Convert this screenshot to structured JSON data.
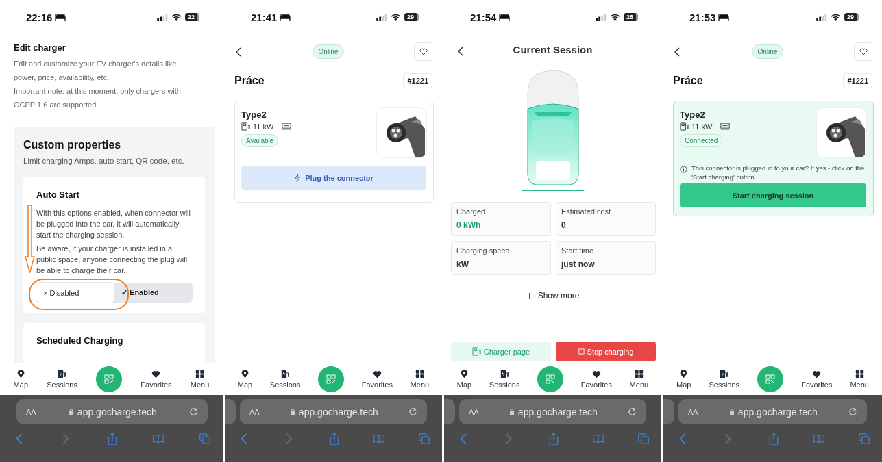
{
  "screens": [
    {
      "kind": "edit_charger",
      "status_bar": {
        "time": "22:16",
        "battery": "22"
      },
      "intro": {
        "title": "Edit charger",
        "paragraphs": [
          "Edit and customize your EV charger's details like power, price, availability, etc.",
          "Important note: at this moment, only chargers with OCPP 1.6 are supported."
        ]
      },
      "section": {
        "title": "Custom properties",
        "subtitle": "Limit charging Amps, auto start, QR code, etc.",
        "cards": [
          {
            "title": "Auto Start",
            "paragraphs": [
              "With this options enabled, when connector will be plugged into the car, it will automatically start the charging session.",
              "Be aware, if your charger is installed in a public space, anyone connecting the plug will be able to charge their car."
            ],
            "options": [
              {
                "icon": "×",
                "label": "Disabled",
                "selected": true
              },
              {
                "icon": "✓",
                "label": "Enabled",
                "selected": false
              }
            ]
          },
          {
            "title": "Scheduled Charging"
          }
        ]
      },
      "nav": [
        "Map",
        "Sessions",
        "Favorites",
        "Menu"
      ],
      "browser": {
        "text_size": "AA",
        "url": "app.gocharge.tech",
        "previous_tab": false
      }
    },
    {
      "kind": "charger",
      "status_bar": {
        "time": "21:41",
        "battery": "29"
      },
      "status": "Online",
      "title": "Práce",
      "number": "#1221",
      "connector": {
        "name": "Type2",
        "power": "11 kW",
        "status": "Available",
        "highlighted": false,
        "action": {
          "kind": "plug",
          "label": "Plug the connector"
        }
      },
      "nav": [
        "Map",
        "Sessions",
        "Favorites",
        "Menu"
      ],
      "browser": {
        "text_size": "AA",
        "url": "app.gocharge.tech",
        "previous_tab": true
      }
    },
    {
      "kind": "session",
      "status_bar": {
        "time": "21:54",
        "battery": "28"
      },
      "title": "Current Session",
      "stats": [
        {
          "label": "Charged",
          "value": "0 kWh",
          "highlight": true
        },
        {
          "label": "Estimated cost",
          "value": "0",
          "highlight": false
        },
        {
          "label": "Charging speed",
          "value": "kW",
          "highlight": false
        },
        {
          "label": "Start time",
          "value": "just now",
          "highlight": false
        }
      ],
      "show_more": "Show more",
      "actions": [
        {
          "kind": "secondary",
          "label": "Charger page"
        },
        {
          "kind": "danger",
          "label": "Stop charging"
        }
      ],
      "nav": [
        "Map",
        "Sessions",
        "Favorites",
        "Menu"
      ],
      "browser": {
        "text_size": "AA",
        "url": "app.gocharge.tech",
        "previous_tab": true
      }
    },
    {
      "kind": "charger",
      "status_bar": {
        "time": "21:53",
        "battery": "29"
      },
      "status": "Online",
      "title": "Práce",
      "number": "#1221",
      "connector": {
        "name": "Type2",
        "power": "11 kW",
        "status": "Connected",
        "highlighted": true,
        "note": "This connector is plugged in to your car? If yes - click on the 'Start charging' button.",
        "action": {
          "kind": "start",
          "label": "Start charging session"
        }
      },
      "nav": [
        "Map",
        "Sessions",
        "Favorites",
        "Menu"
      ],
      "browser": {
        "text_size": "AA",
        "url": "app.gocharge.tech",
        "previous_tab": true
      }
    }
  ]
}
